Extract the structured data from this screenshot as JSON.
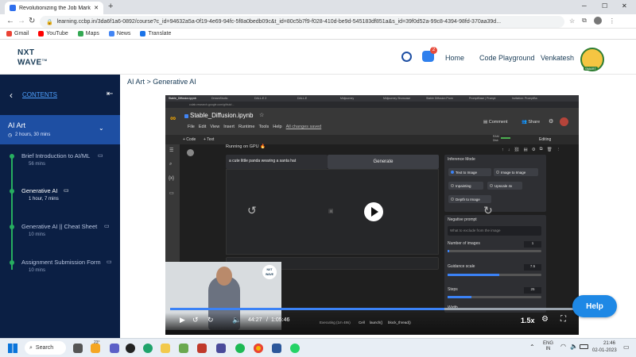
{
  "browser": {
    "tab_title": "Revolutionizing the Job Market |",
    "new_tab": "+",
    "url": "learning.ccbp.in/3da6f1a6-0892/course?c_id=94632a5a-0f19-4e69-94fc-5f8a0bedb09c&t_id=80c5b7f9-f028-410d-be9d-545183df851a&s_id=39f0d52a-99c8-4394-98fd-370aa39d...",
    "bookmarks": [
      "Gmail",
      "YouTube",
      "Maps",
      "News",
      "Translate"
    ]
  },
  "site": {
    "logo_line1": "NXT",
    "logo_line2": "WAVE",
    "logo_tm": "TM",
    "notif_count": "2",
    "nav": [
      "Home",
      "Code Playground"
    ],
    "user_name": "Venkatesh",
    "avatar_badge": "SMART"
  },
  "sidebar": {
    "header": "CONTENTS",
    "section_title": "AI Art",
    "section_meta": "2 hours, 30 mins",
    "items": [
      {
        "label": "Brief Introduction to AI/ML",
        "meta": "56 mins"
      },
      {
        "label": "Generative AI",
        "meta": "1 hour, 7 mins"
      },
      {
        "label": "Generative AI || Cheat Sheet",
        "meta": "10 mins"
      },
      {
        "label": "Assignment Submission Form",
        "meta": "10 mins"
      }
    ]
  },
  "breadcrumb": "AI Art > Generative AI",
  "video": {
    "inner_tabs": [
      "Stable_Diffusion.ipynb",
      "DreamStudio",
      "DALL-E 2",
      "DALL-E",
      "Midjourney",
      "Midjourney Showcase",
      "Stable Diffusion Prom",
      "PromptBase | Prompt",
      "Invitation: PromptBa"
    ],
    "colab_url": "colab.research.google.com/github/...",
    "notebook_title": "Stable_Diffusion.ipynb",
    "menu": [
      "File",
      "Edit",
      "View",
      "Insert",
      "Runtime",
      "Tools",
      "Help"
    ],
    "saved_status": "All changes saved",
    "comment": "Comment",
    "share": "Share",
    "add_code": "+ Code",
    "add_text": "+ Text",
    "ram": "RAM",
    "disk": "Disk",
    "editing": "Editing",
    "running": "Running on GPU 🔥",
    "prompt": "a cute little panda wearing a santa hat",
    "generate": "Generate",
    "inference_mode": "Inference Mode",
    "modes": [
      "Text to Image",
      "Image to Image",
      "Inpainting",
      "Upscale 4x",
      "Depth to Image"
    ],
    "negative_prompt": "Negative prompt",
    "negative_placeholder": "What to exclude from the image",
    "num_images": "Number of images",
    "num_images_val": "1",
    "guidance": "Guidance scale",
    "guidance_val": "7.5",
    "steps": "Steps",
    "steps_val": "25",
    "width": "Width",
    "executing": "Executing (1m 48s)",
    "exec_chain": [
      "Cell",
      "launch()",
      "block_thread()"
    ],
    "presenter_badge": "NXT WAVE",
    "time_current": "44:27",
    "time_sep": "/",
    "time_total": "1:05:46",
    "speed": "1.5x",
    "progress": 0.68
  },
  "help": "Help",
  "taskbar": {
    "search": "Search",
    "weather": "23°",
    "lang_line1": "ENG",
    "lang_line2": "IN",
    "time": "21:46",
    "date": "02-01-2023"
  },
  "colors": {
    "sidebar_bg": "#0b1f44",
    "sidebar_active": "#1e4fa3",
    "accent_green": "#27ae60",
    "help_blue": "#1e88e5",
    "progress_blue": "#3b82f6"
  }
}
